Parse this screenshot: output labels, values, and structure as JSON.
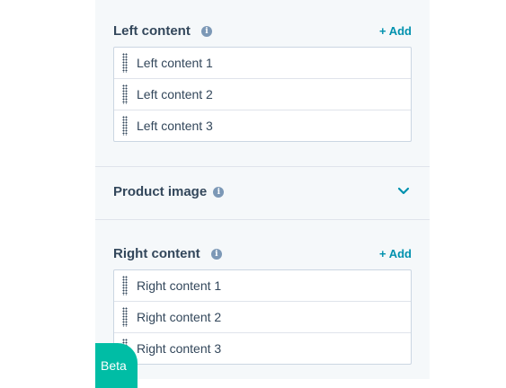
{
  "left_content": {
    "title": "Left content",
    "add_label": "+ Add",
    "items": [
      {
        "label": "Left content 1"
      },
      {
        "label": "Left content 2"
      },
      {
        "label": "Left content 3"
      }
    ]
  },
  "product_image": {
    "title": "Product image"
  },
  "right_content": {
    "title": "Right content",
    "add_label": "+ Add",
    "items": [
      {
        "label": "Right content 1"
      },
      {
        "label": "Right content 2"
      },
      {
        "label": "Right content 3"
      }
    ]
  },
  "beta_badge": {
    "label": "Beta"
  },
  "icons": {
    "info": "info-icon",
    "drag": "drag-handle-icon",
    "chevron": "chevron-down-icon"
  },
  "colors": {
    "panel_bg": "#f5f8fa",
    "text": "#33475b",
    "accent": "#0091ae",
    "info_icon": "#7c98b6",
    "beta": "#00bda5"
  }
}
